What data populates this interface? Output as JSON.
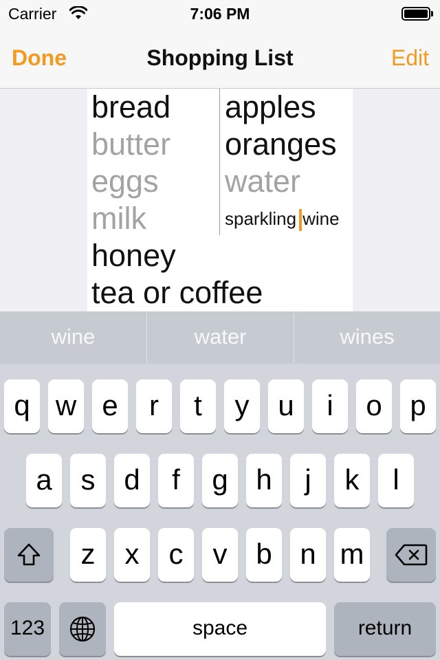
{
  "status_bar": {
    "carrier": "Carrier",
    "time": "7:06 PM"
  },
  "nav": {
    "left_button": "Done",
    "title": "Shopping List",
    "right_button": "Edit"
  },
  "list": {
    "left_column": [
      {
        "text": "bread",
        "checked": false
      },
      {
        "text": "butter",
        "checked": true
      },
      {
        "text": "eggs",
        "checked": true
      },
      {
        "text": "milk",
        "checked": true
      }
    ],
    "right_column": [
      {
        "text": "apples",
        "checked": false
      },
      {
        "text": "oranges",
        "checked": false
      },
      {
        "text": "water",
        "checked": true
      }
    ],
    "editing_before_cursor": "sparkling",
    "editing_after_cursor": "wine",
    "bottom": [
      {
        "text": "honey",
        "checked": false
      },
      {
        "text": "tea or coffee",
        "checked": false
      }
    ]
  },
  "keyboard": {
    "suggestions": [
      "wine",
      "water",
      "wines"
    ],
    "row1": [
      "q",
      "w",
      "e",
      "r",
      "t",
      "y",
      "u",
      "i",
      "o",
      "p"
    ],
    "row2": [
      "a",
      "s",
      "d",
      "f",
      "g",
      "h",
      "j",
      "k",
      "l"
    ],
    "row3": [
      "z",
      "x",
      "c",
      "v",
      "b",
      "n",
      "m"
    ],
    "numbers_label": "123",
    "space_label": "space",
    "return_label": "return"
  },
  "colors": {
    "accent": "#f39a1f",
    "checked_text": "#a3a3a3",
    "keyboard_bg": "#d2d5db"
  }
}
